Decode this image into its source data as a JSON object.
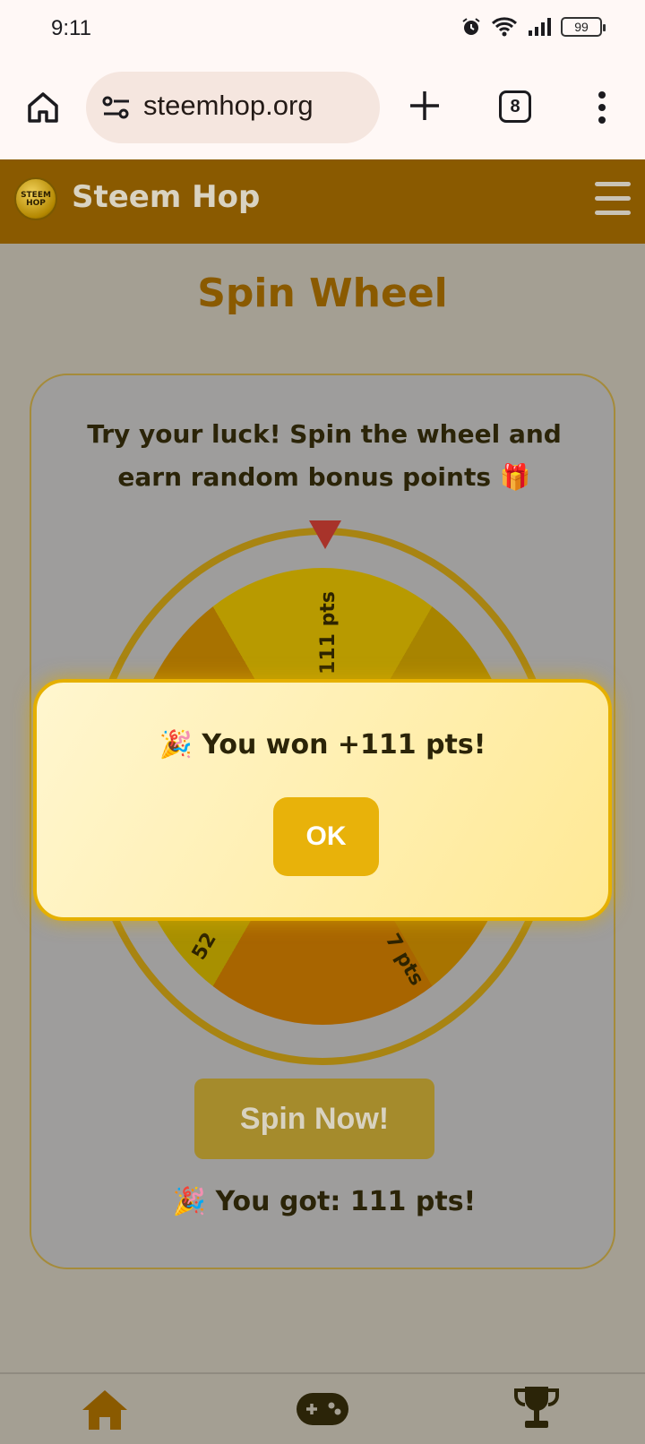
{
  "status_bar": {
    "time": "9:11",
    "battery": "99",
    "icons": [
      "alarm-icon",
      "wifi-icon",
      "signal-icon",
      "battery-icon"
    ]
  },
  "browser": {
    "url": "steemhop.org",
    "tab_count": "8",
    "icons": [
      "home-icon",
      "site-settings-icon",
      "new-tab-icon",
      "tabs-icon",
      "more-icon"
    ]
  },
  "site": {
    "brand": "Steem Hop",
    "logo_text": "STEEM HOP",
    "header_color": "#8a5a00"
  },
  "page": {
    "title": "Spin Wheel",
    "intro": "Try your luck! Spin the wheel and earn random bonus points 🎁",
    "wheel_labels": [
      "111 pts",
      "7 pts",
      "52"
    ],
    "spin_button": "Spin Now!",
    "result": "🎉 You got: 111 pts!"
  },
  "modal": {
    "message": "🎉 You won +111 pts!",
    "ok_button": "OK"
  },
  "bottom_nav": {
    "items": [
      "home-icon",
      "gamepad-icon",
      "trophy-icon"
    ]
  },
  "colors": {
    "accent": "#e8b20a",
    "brand_brown": "#8a5a00",
    "modal_bg": "#fff3c4"
  }
}
